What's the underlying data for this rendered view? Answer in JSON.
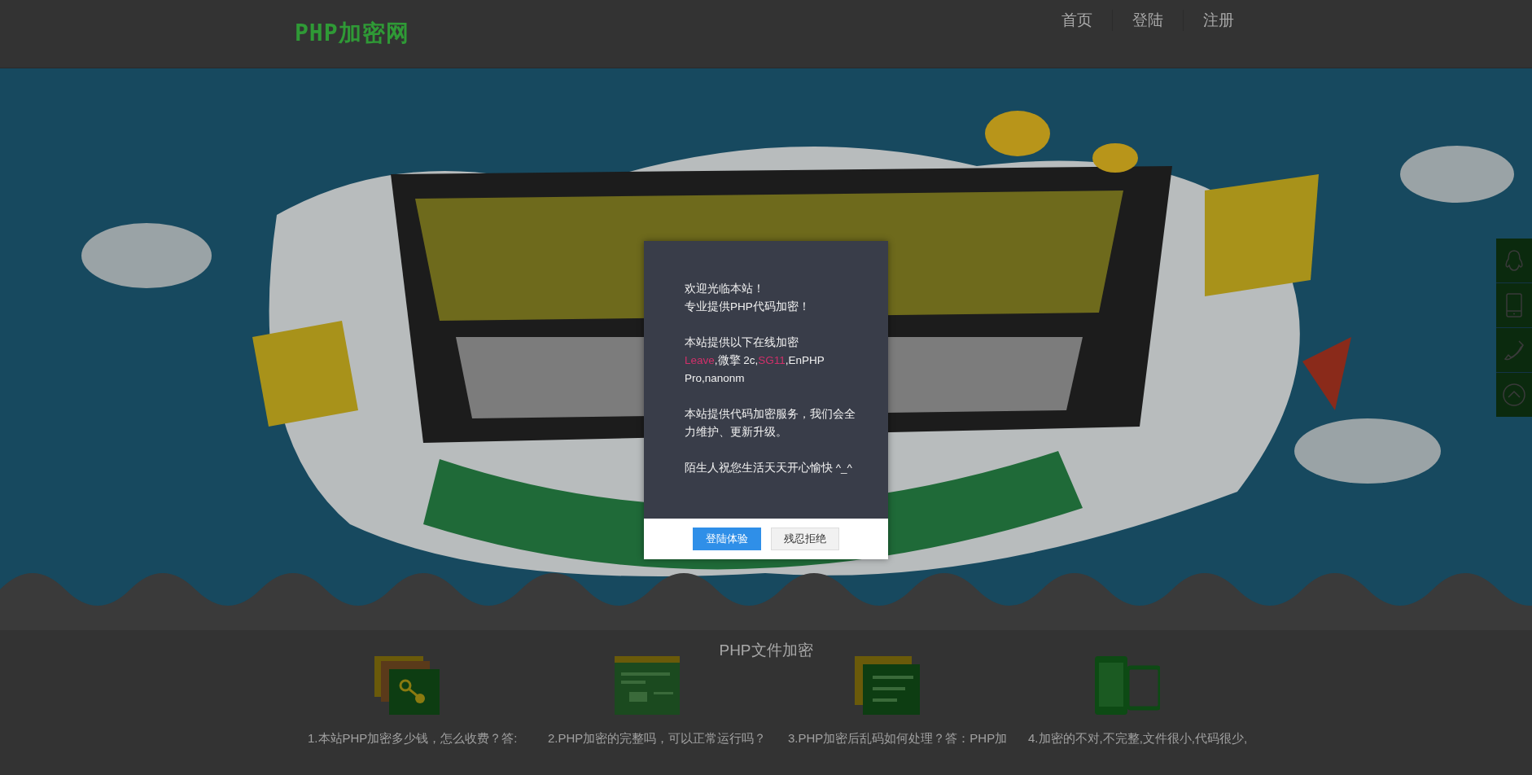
{
  "header": {
    "logo": "PHP加密网",
    "nav": [
      {
        "label": "首页"
      },
      {
        "label": "登陆"
      },
      {
        "label": "注册"
      }
    ]
  },
  "features": {
    "title": "PHP文件加密",
    "items": [
      {
        "caption": "1.本站PHP加密多少钱，怎么收费？答:"
      },
      {
        "caption": "2.PHP加密的完整吗，可以正常运行吗？"
      },
      {
        "caption": "3.PHP加密后乱码如何处理？答：PHP加"
      },
      {
        "caption": "4.加密的不对,不完整,文件很小,代码很少,"
      }
    ]
  },
  "dialog": {
    "paragraphs": [
      {
        "lines": [
          {
            "segments": [
              {
                "text": "欢迎光临本站！",
                "highlight": false
              }
            ]
          },
          {
            "segments": [
              {
                "text": "专业提供PHP代码加密！",
                "highlight": false
              }
            ]
          }
        ]
      },
      {
        "lines": [
          {
            "segments": [
              {
                "text": "本站提供以下在线加密",
                "highlight": false
              }
            ]
          },
          {
            "segments": [
              {
                "text": "Leave",
                "highlight": true
              },
              {
                "text": ",微擎 2c,",
                "highlight": false
              },
              {
                "text": "SG11",
                "highlight": true
              },
              {
                "text": ",EnPHP Pro,nanonm",
                "highlight": false
              }
            ]
          }
        ]
      },
      {
        "lines": [
          {
            "segments": [
              {
                "text": "本站提供代码加密服务，我们会全力维护、更新升级。",
                "highlight": false
              }
            ]
          }
        ]
      },
      {
        "lines": [
          {
            "segments": [
              {
                "text": "陌生人祝您生活天天开心愉快 ^_^",
                "highlight": false
              }
            ]
          }
        ]
      }
    ],
    "buttons": [
      {
        "label": "登陆体验",
        "primary": true
      },
      {
        "label": "残忍拒绝",
        "primary": false
      }
    ]
  }
}
